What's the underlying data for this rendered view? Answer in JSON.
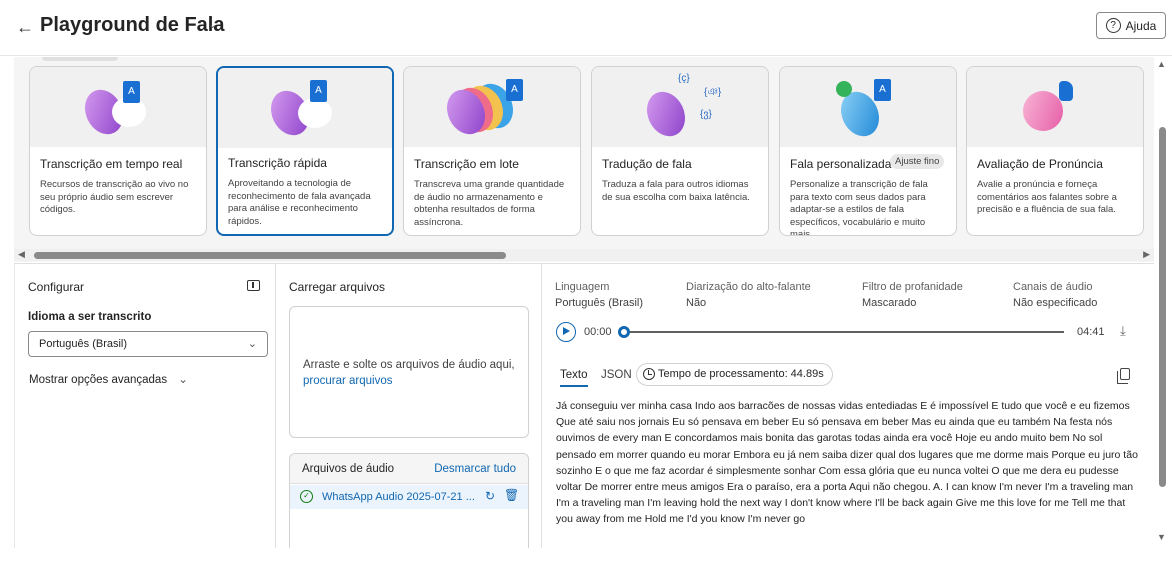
{
  "header": {
    "title": "Playground de Fala",
    "help_label": "Ajuda"
  },
  "cards": [
    {
      "title": "Transcrição em tempo real",
      "desc": "Recursos de transcrição ao vivo no seu próprio áudio sem escrever códigos.",
      "tag": ""
    },
    {
      "title": "Transcrição rápida",
      "desc": "Aproveitando a tecnologia de reconhecimento de fala avançada para análise e reconhecimento rápidos.",
      "tag": ""
    },
    {
      "title": "Transcrição em lote",
      "desc": "Transcreva uma grande quantidade de áudio no armazenamento e obtenha resultados de forma assíncrona.",
      "tag": ""
    },
    {
      "title": "Tradução de fala",
      "desc": "Traduza a fala para outros idiomas de sua escolha com baixa latência.",
      "tag": ""
    },
    {
      "title": "Fala personalizada",
      "desc": "Personalize a transcrição de fala para texto com seus dados para adaptar-se a estilos de fala específicos, vocabulário e muito mais.",
      "tag": "Ajuste fino"
    },
    {
      "title": "Avaliação de Pronúncia",
      "desc": "Avalie a pronúncia e forneça comentários aos falantes sobre a precisão e a fluência de sua fala.",
      "tag": ""
    }
  ],
  "configure": {
    "title": "Configurar",
    "language_label": "Idioma a ser transcrito",
    "language_value": "Português (Brasil)",
    "advanced_label": "Mostrar opções avançadas"
  },
  "upload": {
    "title": "Carregar arquivos",
    "drop_text": "Arraste e solte os arquivos de áudio aqui,",
    "browse_link": "procurar arquivos",
    "files_title": "Arquivos de áudio",
    "deselect_all": "Desmarcar tudo",
    "file_name": "WhatsApp Audio 2025-07-21 ..."
  },
  "result": {
    "meta": [
      {
        "key": "Linguagem",
        "value": "Português (Brasil)"
      },
      {
        "key": "Diarização do alto-falante",
        "value": "Não"
      },
      {
        "key": "Filtro de profanidade",
        "value": "Mascarado"
      },
      {
        "key": "Canais de áudio",
        "value": "Não especificado"
      }
    ],
    "time_current": "00:00",
    "time_total": "04:41",
    "playback_progress": 0,
    "tab_text": "Texto",
    "tab_json": "JSON",
    "processing_time": "Tempo de processamento: 44.89s",
    "transcript": "Já conseguiu ver minha casa Indo aos barracões de nossas vidas entediadas E é impossível E tudo que você e eu fizemos Que até saiu nos jornais Eu só pensava em beber Eu só pensava em beber Mas eu ainda que eu também Na festa nós ouvimos de every man E concordamos mais bonita das garotas todas ainda era você Hoje eu ando muito bem No sol pensado em morrer quando eu morar Embora eu já nem saiba dizer qual dos lugares que me dorme mais Porque eu juro tão sozinho E o que me faz acordar é simplesmente sonhar Com essa glória que eu nunca voltei O que me dera eu pudesse voltar De morrer entre meus amigos Era o paraíso, era a porta Aqui não chegou. A. I can know I'm never I'm a traveling man I'm a traveling man I'm leaving hold the next way I don't know where I'll be back again Give me this love for me Tell me that you away from me Hold me I'd you know I'm never go"
  },
  "colors": {
    "accent": "#1167b1",
    "success": "#107c10"
  }
}
